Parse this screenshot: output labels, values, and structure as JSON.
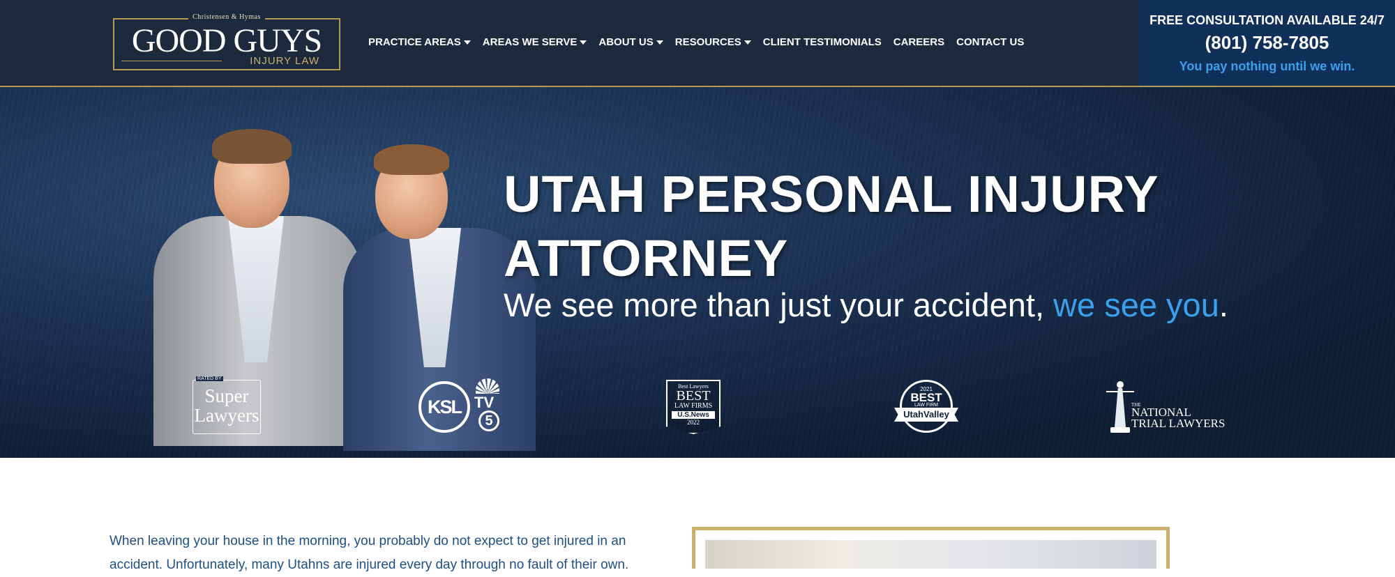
{
  "logo": {
    "top": "Christensen & Hymas",
    "main": "GOOD GUYS",
    "sub": "INJURY LAW"
  },
  "nav": {
    "items": [
      {
        "label": "PRACTICE AREAS",
        "has_dropdown": true
      },
      {
        "label": "AREAS WE SERVE",
        "has_dropdown": true
      },
      {
        "label": "ABOUT US",
        "has_dropdown": true
      },
      {
        "label": "RESOURCES",
        "has_dropdown": true
      },
      {
        "label": "CLIENT TESTIMONIALS",
        "has_dropdown": false
      },
      {
        "label": "CAREERS",
        "has_dropdown": false
      },
      {
        "label": "CONTACT US",
        "has_dropdown": false
      }
    ]
  },
  "consultation": {
    "title": "FREE CONSULTATION AVAILABLE 24/7",
    "phone": "(801) 758-7805",
    "note": "You pay nothing until we win."
  },
  "hero": {
    "title": "UTAH PERSONAL INJURY ATTORNEY",
    "tagline_prefix": "We see more than just your accident, ",
    "tagline_accent": "we see you",
    "tagline_suffix": "."
  },
  "badges": {
    "super_lawyers": {
      "small": "RATED BY",
      "name": "Super Lawyers"
    },
    "ksl": {
      "name": "KSL",
      "tv": "TV",
      "channel": "5"
    },
    "us_news": {
      "l1": "Best Lawyers",
      "l2": "BEST",
      "l3": "LAW FIRMS",
      "l4": "U.S.News",
      "l5": "2022"
    },
    "utah_valley": {
      "year": "2021",
      "best": "BEST",
      "sub": "LAW FIRM",
      "banner": "UtahValley"
    },
    "national_trial": {
      "the": "THE",
      "line1": "NATIONAL",
      "line2": "TRIAL LAWYERS"
    }
  },
  "body": {
    "intro": "When leaving your house in the morning, you probably do not expect to get injured in an accident. Unfortunately, many Utahns are injured every day through no fault of their own."
  },
  "colors": {
    "header_bg": "#1d2a3e",
    "gold": "#b59a57",
    "accent_blue": "#3aa0ee",
    "consult_bg": "#10305a",
    "body_text": "#1f4f82"
  }
}
